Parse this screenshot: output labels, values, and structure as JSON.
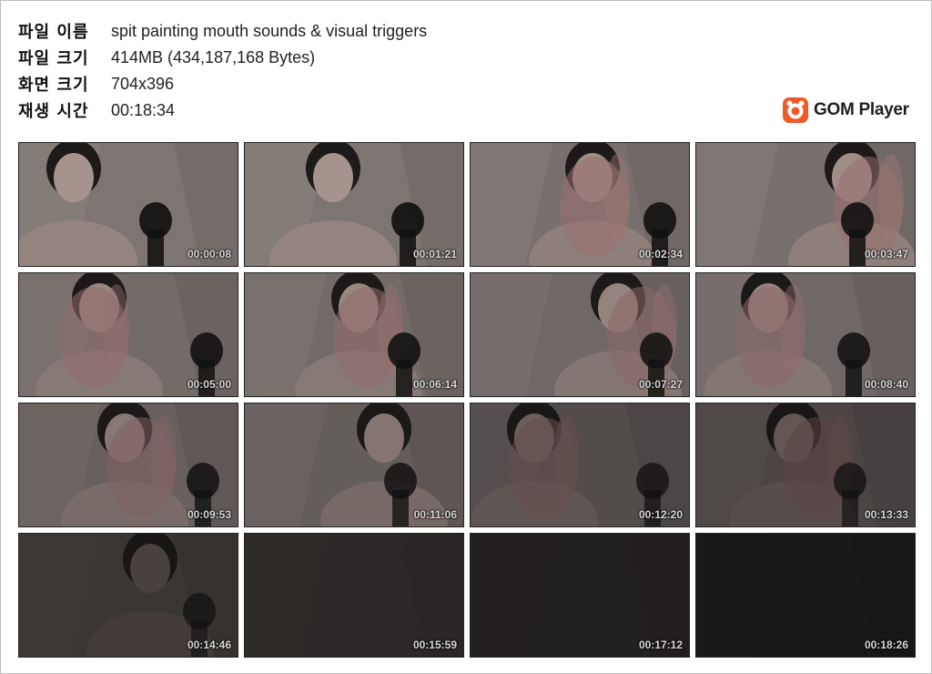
{
  "info": {
    "filename_label": "파일 이름",
    "filename_value": "spit painting mouth sounds & visual triggers",
    "filesize_label": "파일 크기",
    "filesize_value": "414MB (434,187,168 Bytes)",
    "resolution_label": "화면 크기",
    "resolution_value": "704x396",
    "duration_label": "재생 시간",
    "duration_value": "00:18:34"
  },
  "brand": {
    "name": "GOM Player",
    "accent": "#f05a28"
  },
  "thumbnails": [
    {
      "time": "00:00:08",
      "brightness": 0.75,
      "scene": "face-mic"
    },
    {
      "time": "00:01:21",
      "brightness": 0.75,
      "scene": "face-mic"
    },
    {
      "time": "00:02:34",
      "brightness": 0.72,
      "scene": "hand-mouth"
    },
    {
      "time": "00:03:47",
      "brightness": 0.72,
      "scene": "hand-reach"
    },
    {
      "time": "00:05:00",
      "brightness": 0.68,
      "scene": "hand-blur"
    },
    {
      "time": "00:06:14",
      "brightness": 0.68,
      "scene": "hand-blur"
    },
    {
      "time": "00:07:27",
      "brightness": 0.66,
      "scene": "hand-blur"
    },
    {
      "time": "00:08:40",
      "brightness": 0.66,
      "scene": "hand-mouth"
    },
    {
      "time": "00:09:53",
      "brightness": 0.6,
      "scene": "hand-blur"
    },
    {
      "time": "00:11:06",
      "brightness": 0.58,
      "scene": "face-mic"
    },
    {
      "time": "00:12:20",
      "brightness": 0.45,
      "scene": "hand-reach"
    },
    {
      "time": "00:13:33",
      "brightness": 0.4,
      "scene": "hand-reach"
    },
    {
      "time": "00:14:46",
      "brightness": 0.28,
      "scene": "dark"
    },
    {
      "time": "00:15:59",
      "brightness": 0.18,
      "scene": "dark"
    },
    {
      "time": "00:17:12",
      "brightness": 0.12,
      "scene": "dark"
    },
    {
      "time": "00:18:26",
      "brightness": 0.05,
      "scene": "dark"
    }
  ]
}
